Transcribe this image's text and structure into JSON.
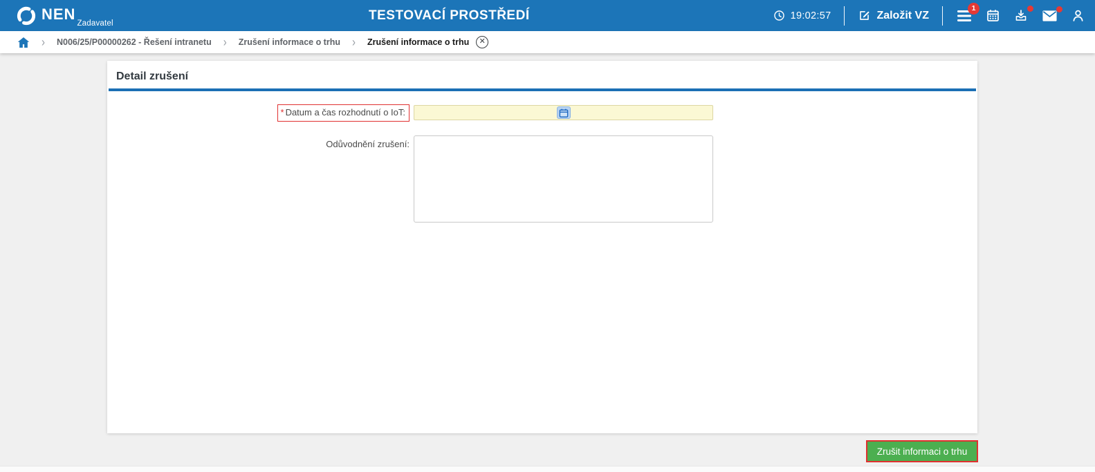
{
  "header": {
    "brand": "NEN",
    "brand_subtitle": "Zadavatel",
    "environment_title": "TESTOVACÍ PROSTŘEDÍ",
    "clock_time": "19:02:57",
    "create_vz_label": "Založit VZ",
    "menu_badge_count": "1",
    "icons": {
      "clock": "clock-icon",
      "edit": "edit-icon",
      "menu": "hamburger-menu-icon",
      "calendar": "calendar-icon",
      "downloads": "download-tray-icon",
      "mail": "mail-icon",
      "user": "user-icon"
    }
  },
  "breadcrumb": {
    "items": [
      {
        "label": "N006/25/P00000262 - Řešení intranetu"
      },
      {
        "label": "Zrušení informace o trhu"
      },
      {
        "label": "Zrušení informace o trhu"
      }
    ],
    "separator": "›",
    "close_glyph": "✕"
  },
  "main": {
    "panel_title": "Detail zrušení",
    "fields": {
      "datetime": {
        "label": "Datum a čas rozhodnutí o IoT:",
        "required_marker": "*",
        "value": "",
        "type": "datetime"
      },
      "reason": {
        "label": "Odůvodnění zrušení:",
        "value": "",
        "type": "textarea"
      }
    }
  },
  "footer": {
    "submit_label": "Zrušit informaci o trhu"
  },
  "colors": {
    "header_blue": "#1c75b8",
    "rule_blue": "#1b6fb5",
    "badge_red": "#e53935",
    "required_red": "#e03030",
    "field_yellow": "#fbf8d4",
    "button_green": "#4caf50",
    "page_bg": "#f0f0f0"
  }
}
